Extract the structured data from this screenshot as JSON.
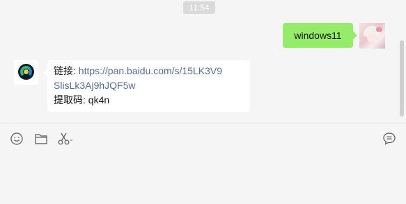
{
  "chat": {
    "timestamp": "11:54",
    "messages": [
      {
        "sender": "me",
        "text": "windows11"
      },
      {
        "sender": "other",
        "link_label": "链接: ",
        "link_url_line1": "https://pan.baidu.com/s/15LK3V9",
        "link_url_line2": "SlisLk3Aj9hJQF5w",
        "code_line": "提取码: qk4n"
      }
    ]
  },
  "toolbar": {
    "icons": [
      "emoji-icon",
      "folder-icon",
      "scissors-icon",
      "chat-history-icon"
    ]
  },
  "colors": {
    "background": "#f5f5f5",
    "my_bubble": "#95ec69",
    "other_bubble": "#ffffff",
    "link": "#576b95"
  }
}
